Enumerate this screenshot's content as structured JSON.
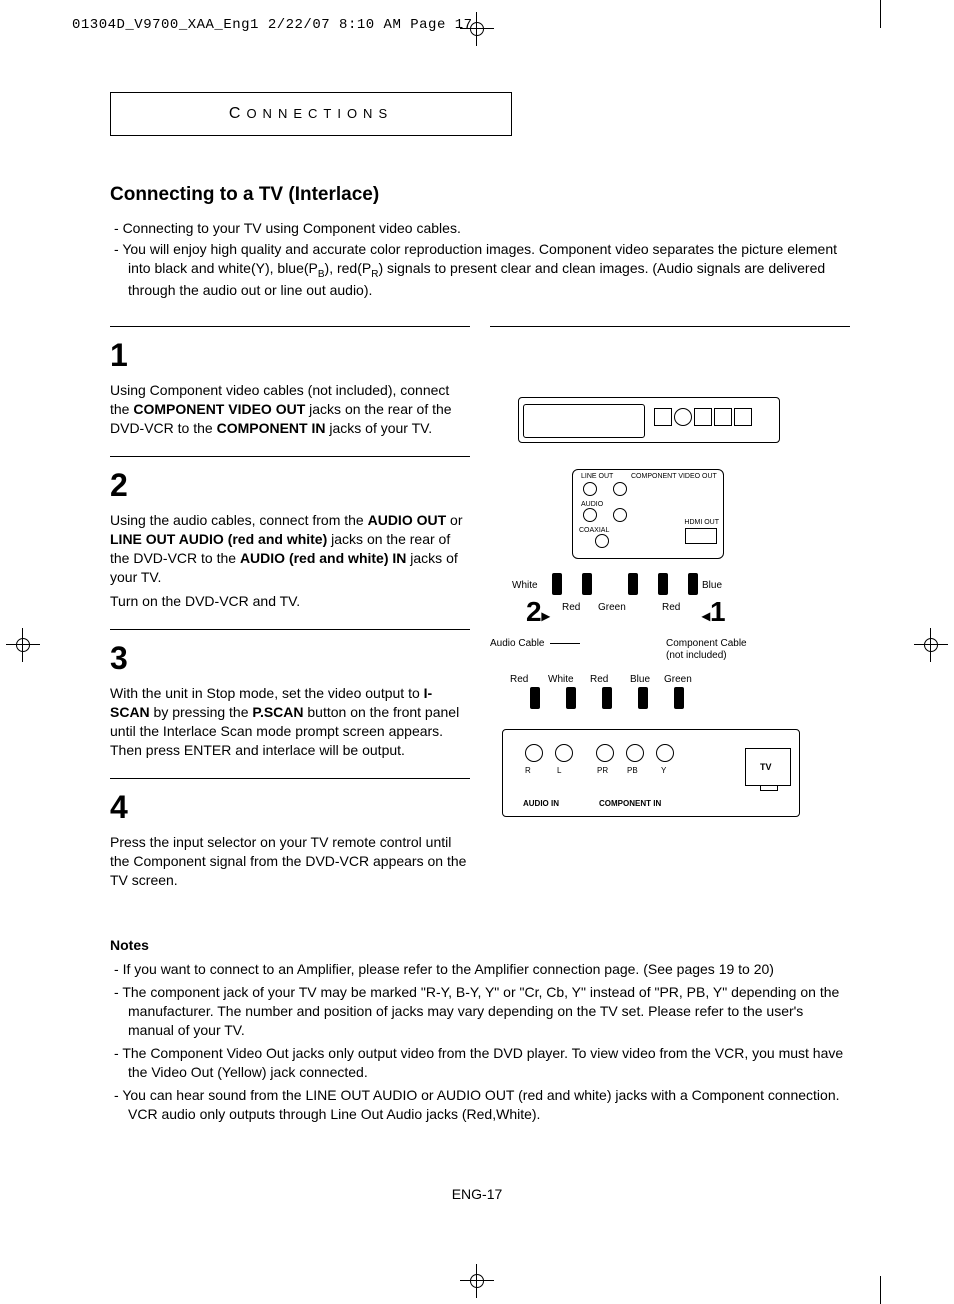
{
  "print_header": "01304D_V9700_XAA_Eng1  2/22/07  8:10 AM  Page 17",
  "section_label": "CONNECTIONS",
  "title": "Connecting to a TV (Interlace)",
  "intro": [
    "Connecting to your TV using Component video cables.",
    "You will enjoy high quality and accurate color reproduction images. Component video separates the picture element into black and white(Y), blue(P_B), red(P_R) signals to present clear and clean images. (Audio signals are delivered through the audio out or line out audio)."
  ],
  "steps": [
    {
      "num": "1",
      "html": "Using Component video cables (not included), connect the <b>COMPONENT VIDEO OUT</b> jacks on the rear of the DVD-VCR to the <b>COMPONENT IN</b> jacks of your TV."
    },
    {
      "num": "2",
      "html": "Using the audio cables, connect from the <b>AUDIO OUT</b> or <b>LINE OUT AUDIO (red and white)</b>  jacks on the rear of the DVD-VCR to the <b>AUDIO (red and white) IN</b> jacks of your TV.",
      "extra": "Turn on the DVD-VCR and TV."
    },
    {
      "num": "3",
      "html": "With the unit in Stop mode, set the video output to <b>I-SCAN</b> by pressing the <b>P.SCAN</b> button on the front panel until the Interlace Scan mode prompt screen appears. Then press ENTER and interlace will be output."
    },
    {
      "num": "4",
      "html": "Press the input selector on your TV remote control until the Component signal from the DVD-VCR appears on the TV screen."
    }
  ],
  "diagram": {
    "back_labels": {
      "lineout": "LINE OUT",
      "compvidout": "COMPONENT VIDEO OUT",
      "audio": "AUDIO",
      "coaxial": "COAXIAL",
      "hdmiout": "HDMI OUT"
    },
    "colors": {
      "white": "White",
      "red": "Red",
      "green": "Green",
      "blue": "Blue"
    },
    "cable_labels": {
      "audio": "Audio Cable",
      "component": "Component Cable",
      "not_included": "(not included)"
    },
    "big1": "1",
    "big2": "2",
    "tv": {
      "label": "TV",
      "audio_in": "AUDIO IN",
      "component_in": "COMPONENT IN",
      "r": "R",
      "l": "L",
      "pr": "PR",
      "pb": "PB",
      "y": "Y"
    }
  },
  "notes_title": "Notes",
  "notes": [
    "If you want to connect to an Amplifier, please refer to the Amplifier connection page. (See pages 19 to 20)",
    "The component jack of your TV may be marked \"R-Y, B-Y, Y\" or \"Cr, Cb, Y\" instead of \"PR, PB, Y\" depending on the manufacturer. The number and position of jacks may vary depending on the TV set. Please refer to the user's manual of your TV.",
    "The Component Video Out jacks only output video from the DVD player. To view video from the VCR, you must have the Video Out (Yellow) jack connected.",
    "You can hear sound from the LINE OUT AUDIO or AUDIO OUT (red and white) jacks with a Component connection. VCR audio only outputs through Line Out Audio jacks (Red,White)."
  ],
  "page_footer": "ENG-17"
}
